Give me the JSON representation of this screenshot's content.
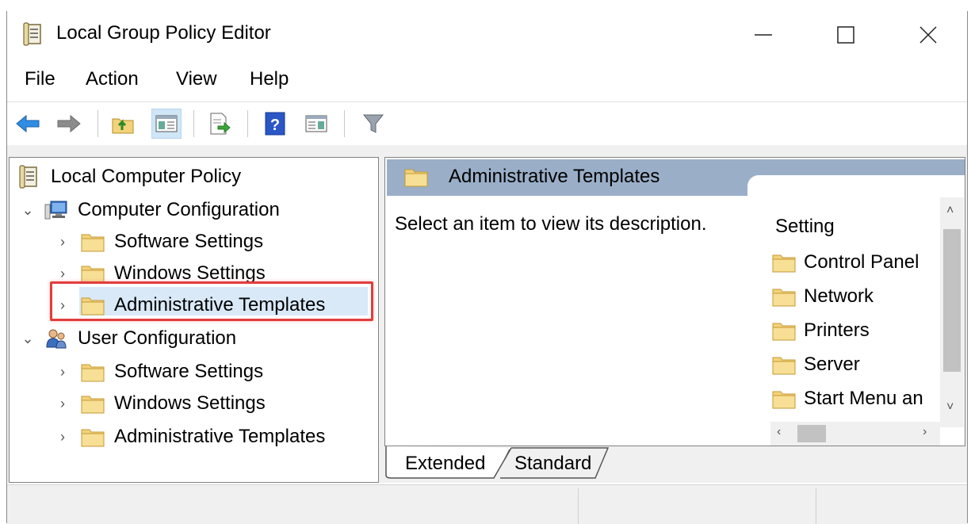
{
  "window": {
    "title": "Local Group Policy Editor",
    "app_icon": "policy-document-icon",
    "controls": [
      "minimize-icon",
      "maximize-icon",
      "close-icon"
    ]
  },
  "menu": {
    "items": [
      {
        "label": "File"
      },
      {
        "label": "Action"
      },
      {
        "label": "View"
      },
      {
        "label": "Help"
      }
    ]
  },
  "toolbar": {
    "buttons": [
      {
        "icon": "back-arrow-icon"
      },
      {
        "icon": "forward-arrow-icon"
      },
      {
        "icon": "up-folder-icon"
      },
      {
        "icon": "show-hide-console-tree-icon",
        "pressed": true
      },
      {
        "icon": "export-list-icon"
      },
      {
        "icon": "help-icon"
      },
      {
        "icon": "show-hide-action-pane-icon"
      },
      {
        "icon": "filter-icon"
      }
    ]
  },
  "tree": {
    "root": "Local Computer Policy",
    "computer_config": "Computer Configuration",
    "user_config": "User Configuration",
    "computer_children": [
      "Software Settings",
      "Windows Settings",
      "Administrative Templates"
    ],
    "user_children": [
      "Software Settings",
      "Windows Settings",
      "Administrative Templates"
    ],
    "selected": "Administrative Templates"
  },
  "detail": {
    "header_title": "Administrative Templates",
    "description": "Select an item to view its description.",
    "column_header": "Setting",
    "items": [
      "Control Panel",
      "Network",
      "Printers",
      "Server",
      "Start Menu an"
    ]
  },
  "tabs": [
    {
      "label": "Extended",
      "active": true
    },
    {
      "label": "Standard",
      "active": false
    }
  ],
  "colors": {
    "highlight_border": "#e23d3d",
    "header_band": "#9aaec8",
    "selection": "#d9e9f8",
    "folder": "#f3d27a"
  }
}
